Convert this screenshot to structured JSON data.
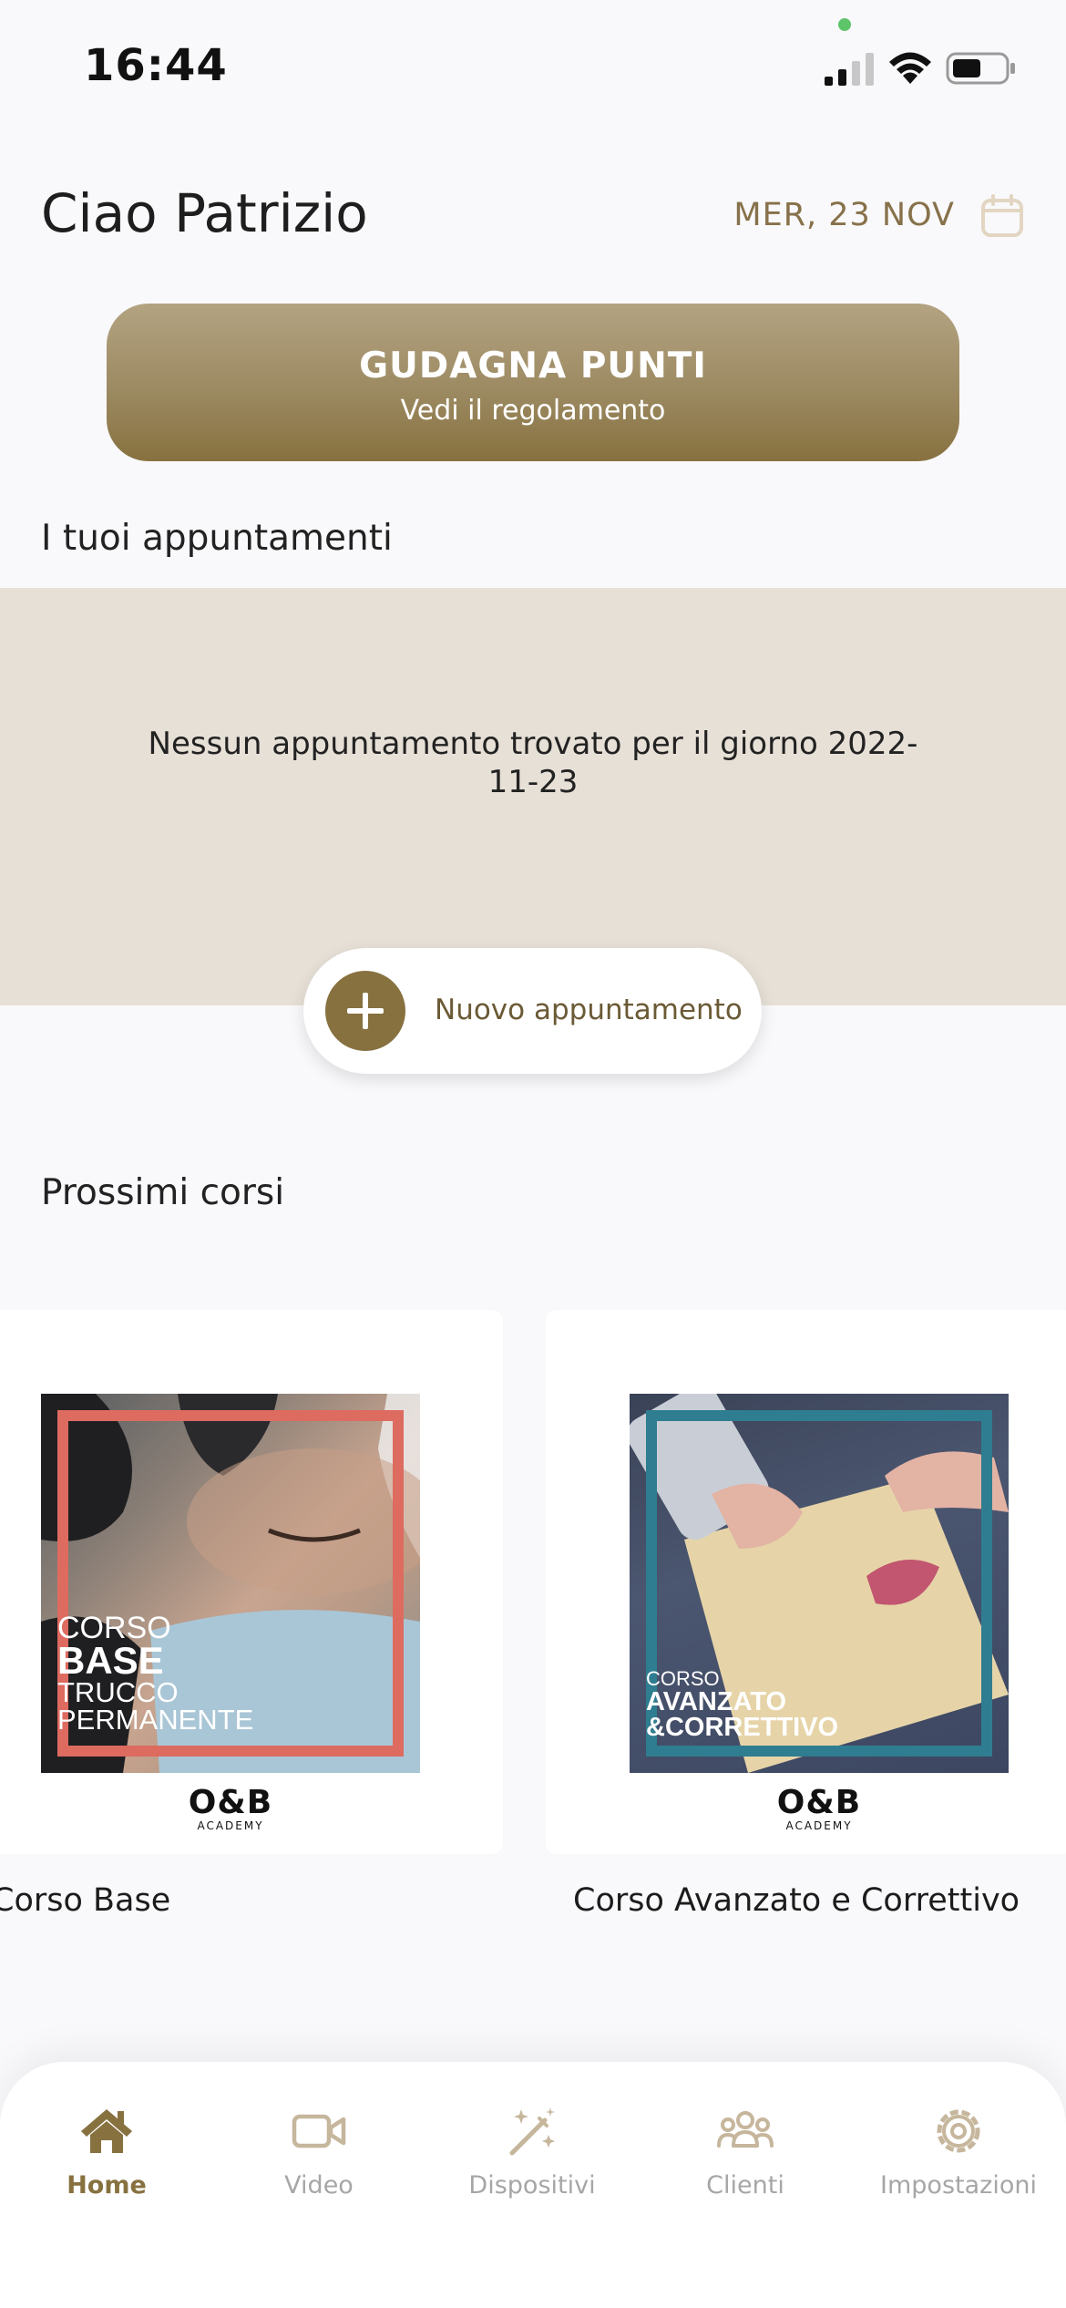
{
  "status_bar": {
    "time": "16:44"
  },
  "header": {
    "greeting": "Ciao Patrizio",
    "date": "MER, 23 NOV"
  },
  "points_button": {
    "title": "GUDAGNA PUNTI",
    "subtitle": "Vedi il regolamento"
  },
  "appointments": {
    "title": "I tuoi appuntamenti",
    "empty_message": "Nessun appuntamento trovato per il giorno 2022-11-23",
    "new_button_label": "Nuovo appuntamento"
  },
  "courses": {
    "title": "Prossimi corsi",
    "items": [
      {
        "name": "Corso Base",
        "poster_line1": "CORSO",
        "poster_line2": "BASE",
        "poster_line3": "TRUCCO",
        "poster_line4": "PERMANENTE",
        "logo": "O&B",
        "logo_sub": "ACADEMY"
      },
      {
        "name": "Corso Avanzato e Correttivo",
        "poster_line1": "CORSO",
        "poster_line2": "AVANZATO",
        "poster_line3": "&CORRETTIVO",
        "logo": "O&B",
        "logo_sub": "ACADEMY"
      }
    ]
  },
  "bottom_nav": {
    "items": [
      {
        "label": "Home",
        "icon": "home-icon",
        "active": true
      },
      {
        "label": "Video",
        "icon": "video-icon"
      },
      {
        "label": "Dispositivi",
        "icon": "magic-wand-icon"
      },
      {
        "label": "Clienti",
        "icon": "users-icon"
      },
      {
        "label": "Impostazioni",
        "icon": "gear-icon"
      }
    ]
  },
  "colors": {
    "accent": "#87713f",
    "panel": "#e7e0d7",
    "background": "#f9f9fb"
  }
}
